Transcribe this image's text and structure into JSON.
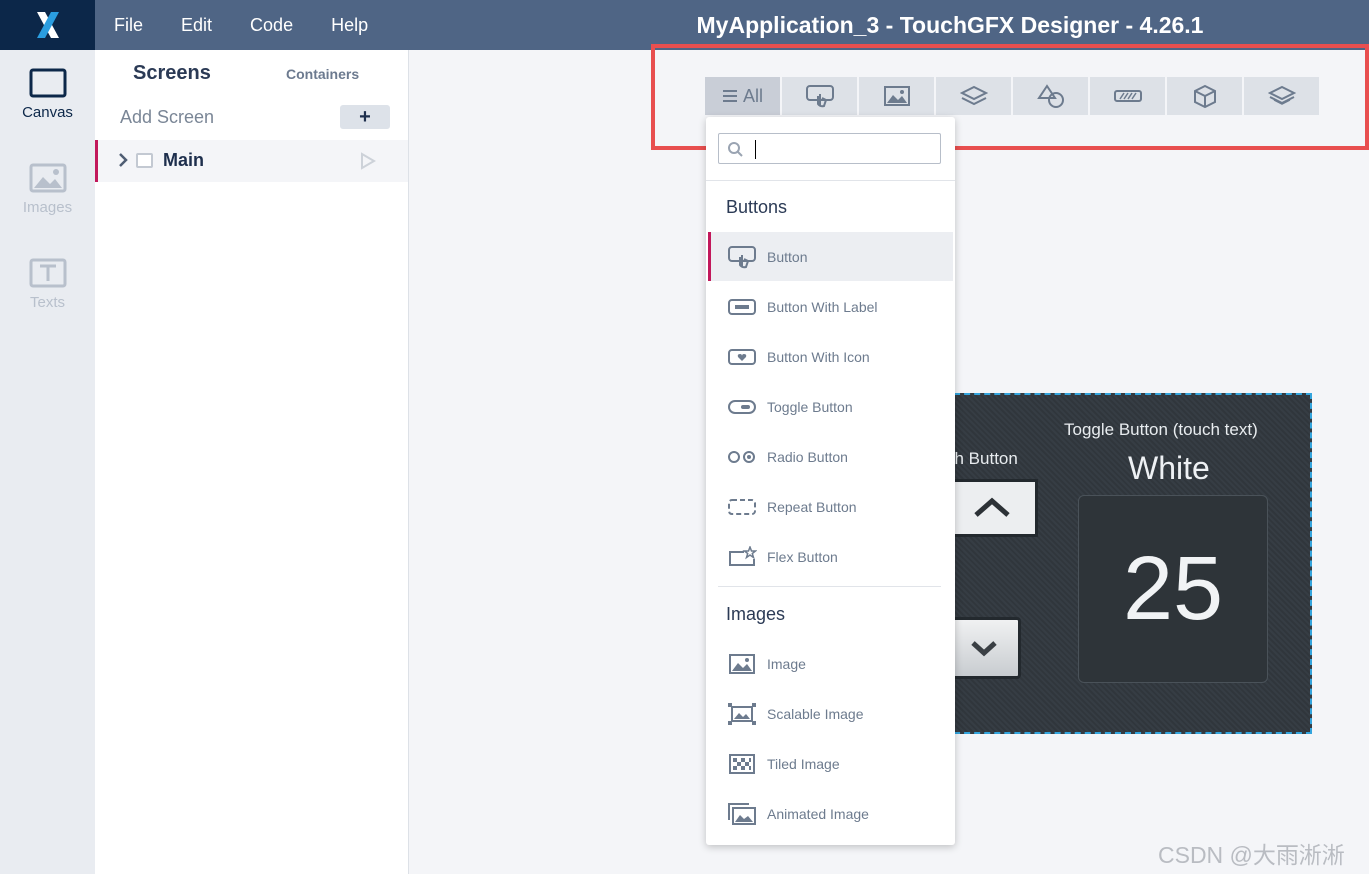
{
  "app": {
    "title": "MyApplication_3 - TouchGFX Designer - 4.26.1",
    "menu": [
      "File",
      "Edit",
      "Code",
      "Help"
    ]
  },
  "rail": {
    "items": [
      {
        "label": "Canvas",
        "icon": "canvas-icon",
        "active": true
      },
      {
        "label": "Images",
        "icon": "image-icon",
        "active": false
      },
      {
        "label": "Texts",
        "icon": "text-icon",
        "active": false
      }
    ]
  },
  "panel": {
    "tabs": {
      "screens": "Screens",
      "containers": "Containers"
    },
    "add_screen_label": "Add Screen",
    "add_button": "+",
    "screens": [
      {
        "name": "Main"
      }
    ]
  },
  "toolbar": {
    "all_label": "All",
    "categories": [
      "all",
      "buttons",
      "images",
      "containers",
      "shapes",
      "progress-indicators",
      "3d",
      "layers"
    ]
  },
  "dropdown": {
    "search": {
      "placeholder": "",
      "value": ""
    },
    "sections": [
      {
        "title": "Buttons",
        "items": [
          "Button",
          "Button With Label",
          "Button With Icon",
          "Toggle Button",
          "Radio Button",
          "Repeat Button",
          "Flex Button"
        ]
      },
      {
        "title": "Images",
        "items": [
          "Image",
          "Scalable Image",
          "Tiled Image",
          "Animated Image"
        ]
      }
    ],
    "selected": "Button"
  },
  "preview": {
    "toggle_label": "Toggle Button (touch text)",
    "toggle_value": "White",
    "touch_label": "ch Button",
    "counter": "25"
  },
  "watermark": "CSDN @大雨淅淅",
  "colors": {
    "topbar": "#4f6585",
    "logo_bg": "#0c2749",
    "accent": "#c2185b",
    "highlight": "#e84f4f",
    "selection_border": "#33a4dd"
  }
}
